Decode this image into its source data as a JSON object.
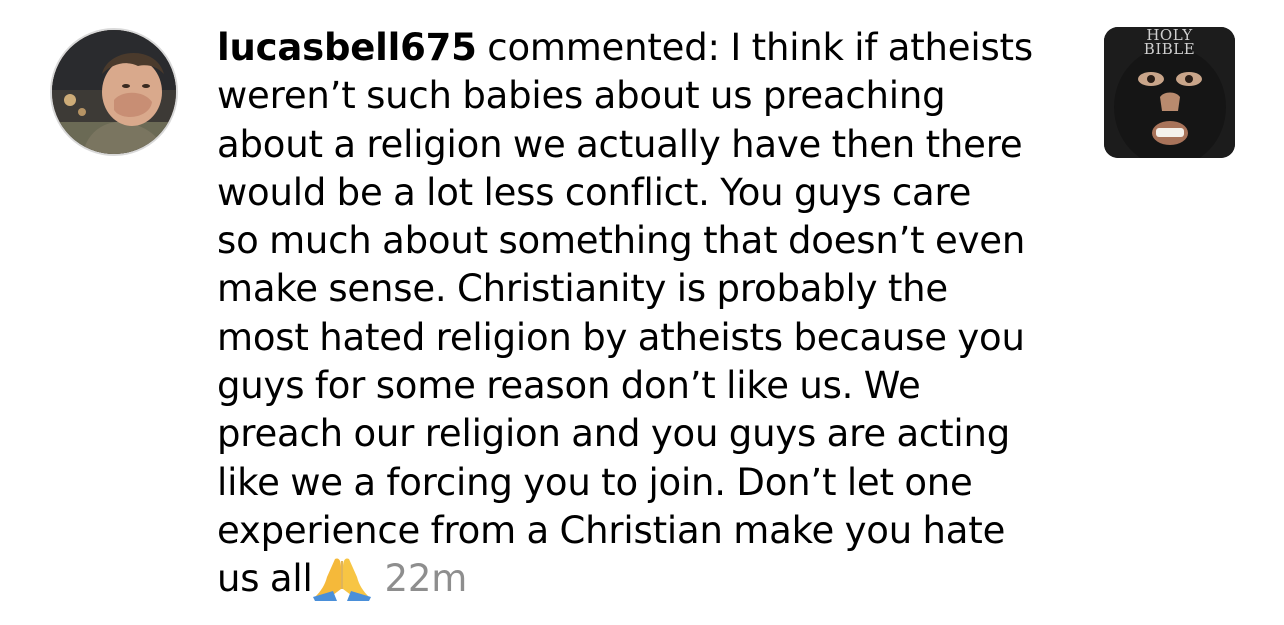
{
  "notification": {
    "username": "lucasbell675",
    "action": " commented: I think if atheists",
    "comment_lines": [
      "weren’t such babies about us preaching",
      "about a religion we actually have then there",
      "would be a lot less conflict. You guys care",
      "so much about something that doesn’t even",
      "make sense. Christianity is probably the",
      "most hated religion by atheists because you",
      "guys for some reason don’t like us. We",
      "preach our religion and you guys are acting",
      "like we a forcing you to join. Don’t let one",
      "experience from a Christian make you hate"
    ],
    "last_line": "us all",
    "emoji": "folded-hands-emoji",
    "timestamp": "22m",
    "timestamp_color": "#8e8e8e",
    "avatar_icon": "profile-photo",
    "thumbnail": {
      "line1": "HOLY",
      "line2": "BIBLE"
    }
  }
}
